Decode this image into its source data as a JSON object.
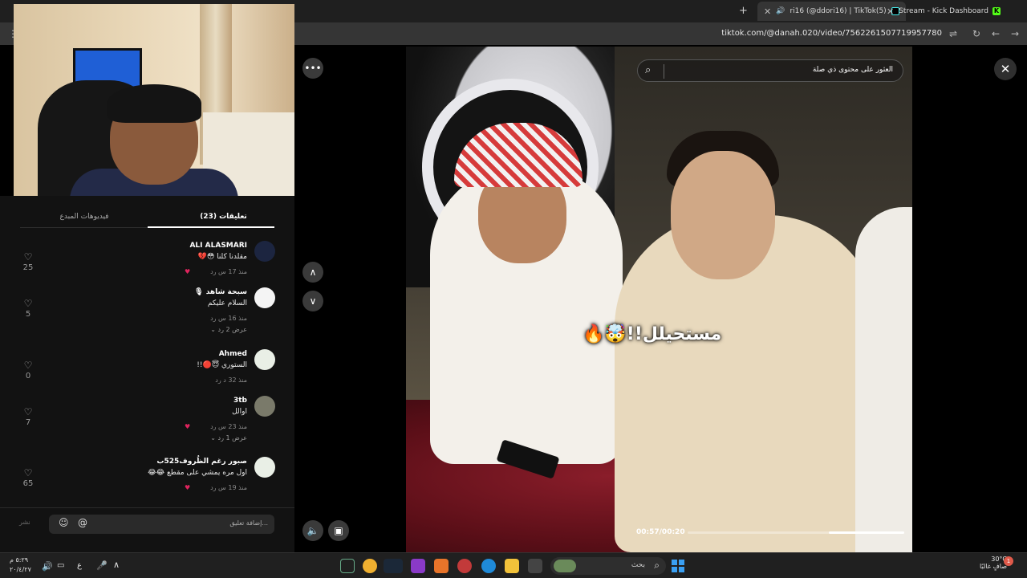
{
  "browser": {
    "tabs": [
      {
        "title": "ri16 (@ddori16) | TikTok(5)",
        "active": true
      },
      {
        "title": "Stream - Kick Dashboard",
        "active": false
      }
    ],
    "new_tab": "+",
    "url": "tiktok.com/@danah.020/video/7562261507719957780"
  },
  "comments_panel": {
    "tab_comments": "(23) تعليقات",
    "tab_creator": "فيديوهات المبدع",
    "comments": [
      {
        "name": "ALI ALASMARI",
        "text": "مقلدنا كلنا 😳💔",
        "meta": "منذ 17 س   رد",
        "likes": "25",
        "replies": ""
      },
      {
        "name": "سبحة شاهد 🎙",
        "text": "السلام عليكم",
        "meta": "منذ 16 س   رد",
        "likes": "5",
        "replies": "عرض 2 رد ⌄"
      },
      {
        "name": "Ahmed",
        "text": "الستوري 😇🔴!!",
        "meta": "منذ 32 د   رد",
        "likes": "0",
        "replies": ""
      },
      {
        "name": "3tb",
        "text": "اوالل",
        "meta": "منذ 23 س   رد",
        "likes": "7",
        "replies": "عرض 1 رد ⌄"
      },
      {
        "name": "صبور رغم الظُروف525ب",
        "text": "اول مره يمشي على مقطع 😂😂",
        "meta": "منذ 19 س   رد",
        "likes": "65",
        "replies": ""
      }
    ],
    "input_placeholder": "إضافة تعليق...",
    "post_label": "نشر"
  },
  "video": {
    "search_text": "العثور على محتوى ذي صلة",
    "caption": "مستحيلل!!🤯🔥",
    "time": "00:57/00:20",
    "progress": 0.35
  },
  "taskbar": {
    "search_text": "بحث",
    "time": "٥:٢٩ م",
    "date": "٢٠/٤/٢٧",
    "lang": "ع",
    "weather_temp": "30°C",
    "weather_desc": "صافٍ غالبًا",
    "notifications": "1"
  },
  "colors": {
    "panel_bg": "#121212",
    "taskbar_bg": "#202020",
    "accent_kick": "#53fc18",
    "start_blue": "#3aa0f3"
  }
}
